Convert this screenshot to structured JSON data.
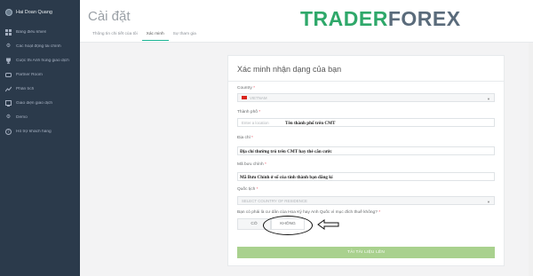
{
  "sidebar": {
    "profile_name": "Hai Doan Quang",
    "items": [
      {
        "label": "Bảng điều khiển",
        "icon": "dashboard-icon"
      },
      {
        "label": "Các hoạt động tài chính",
        "icon": "gear-icon"
      },
      {
        "label": "Cuộc thi Anh hùng giao dịch",
        "icon": "trophy-icon"
      },
      {
        "label": "Partner Room",
        "icon": "partner-icon"
      },
      {
        "label": "Phân tích",
        "icon": "chart-line-icon"
      },
      {
        "label": "Giao diện giao dịch",
        "icon": "terminal-icon"
      },
      {
        "label": "Demo",
        "icon": "settings-icon"
      },
      {
        "label": "Hỗ trợ khách hàng",
        "icon": "help-icon"
      }
    ]
  },
  "header": {
    "title": "Cài đặt",
    "tabs": [
      {
        "label": "Thông tin chi tiết của tôi",
        "active": false
      },
      {
        "label": "Xác minh",
        "active": true
      },
      {
        "label": "Sự tham gia",
        "active": false
      }
    ]
  },
  "logo": {
    "part1": "TRADER",
    "part2": "FOREX"
  },
  "form": {
    "title": "Xác minh nhận dạng của bạn",
    "country_label": "Country",
    "country_value": "VIETNAM",
    "city_label": "Thành phố",
    "city_placeholder": "Enter a location",
    "city_note": "Tên thành phố trên CMT",
    "address_label": "Địa chỉ",
    "address_note": "Địa chỉ thường trú trên CMT hay thẻ căn cước",
    "postal_label": "Mã bưu chính",
    "postal_note": "Mã Bưu Chính ở số của tỉnh thành bạn đăng kí",
    "citizenship_label": "Quốc tịch",
    "citizenship_placeholder": "SELECT COUNTRY OF RESIDENCE",
    "us_question": "Bạn có phải là cư dân của Hoa Kỳ hay Anh Quốc vì mục đích thuế không?",
    "yes_label": "CÓ",
    "no_label": "KHÔNG",
    "upload_label": "TẢI TÀI LIỆU LÊN",
    "required_mark": "*"
  },
  "colors": {
    "sidebar_bg": "#2b3a4b",
    "active_tab": "#1ab394",
    "upload_button": "#a9d18e",
    "logo_green": "#2fa86a"
  }
}
